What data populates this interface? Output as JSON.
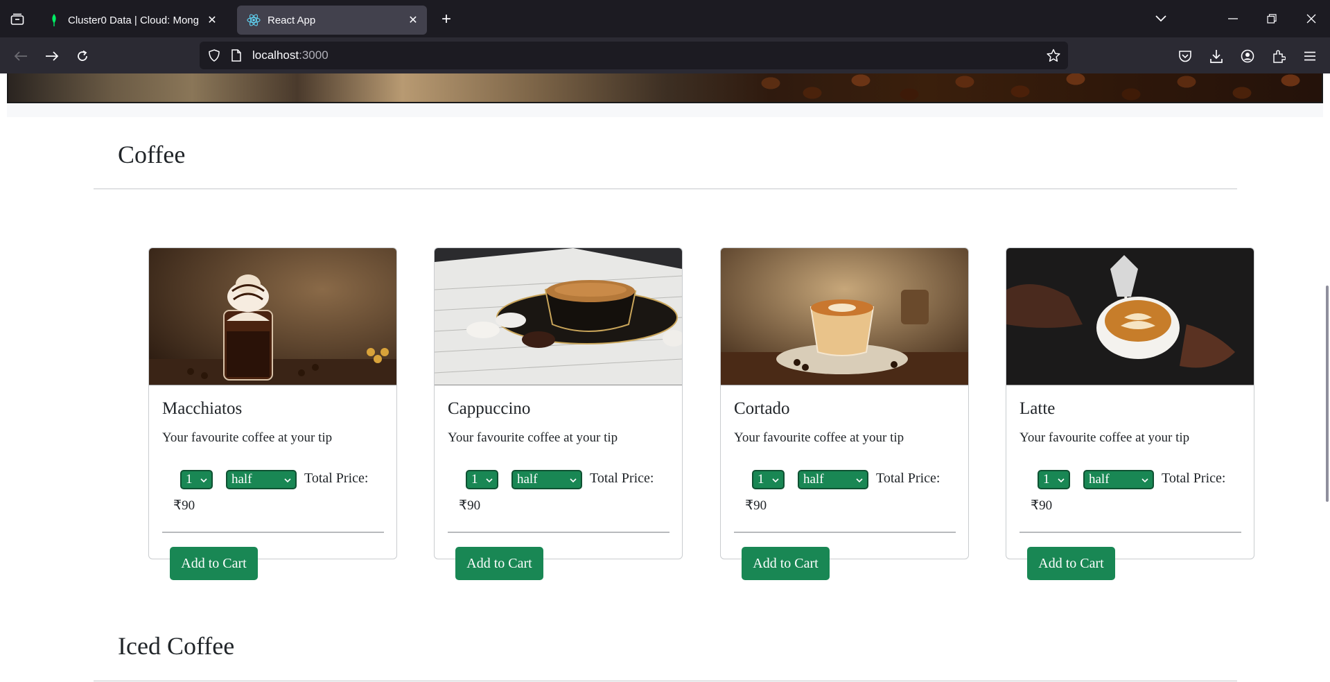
{
  "browser": {
    "tabs": [
      {
        "title": "Cluster0 Data | Cloud: MongoDB Cloud",
        "icon": "mongodb-leaf-icon",
        "active": false
      },
      {
        "title": "React App",
        "icon": "react-icon",
        "active": true
      }
    ],
    "url": {
      "host": "localhost",
      "port": ":3000"
    }
  },
  "sections": [
    {
      "title": "Coffee",
      "items": [
        {
          "name": "Macchiatos",
          "description": "Your favourite coffee at your tip",
          "qty": "1",
          "size": "half",
          "price_label": "Total Price:",
          "price": "₹90",
          "button": "Add to Cart"
        },
        {
          "name": "Cappuccino",
          "description": "Your favourite coffee at your tip",
          "qty": "1",
          "size": "half",
          "price_label": "Total Price:",
          "price": "₹90",
          "button": "Add to Cart"
        },
        {
          "name": "Cortado",
          "description": "Your favourite coffee at your tip",
          "qty": "1",
          "size": "half",
          "price_label": "Total Price:",
          "price": "₹90",
          "button": "Add to Cart"
        },
        {
          "name": "Latte",
          "description": "Your favourite coffee at your tip",
          "qty": "1",
          "size": "half",
          "price_label": "Total Price:",
          "price": "₹90",
          "button": "Add to Cart"
        }
      ]
    },
    {
      "title": "Iced Coffee"
    }
  ],
  "colors": {
    "accent": "#198754",
    "chrome_bg": "#1c1b22",
    "toolbar_bg": "#2b2a33"
  }
}
